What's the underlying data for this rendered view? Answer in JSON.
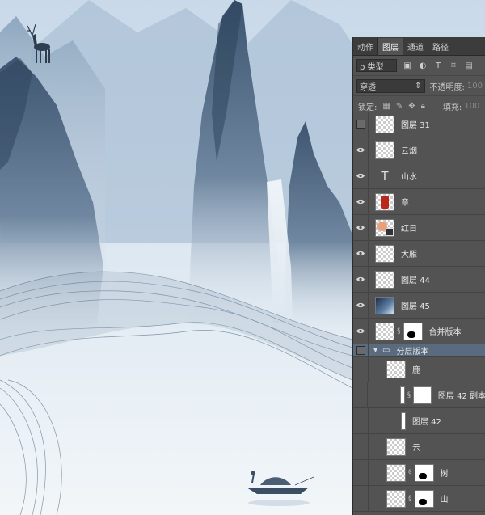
{
  "panel": {
    "tabs": [
      "动作",
      "图层",
      "通道",
      "路径"
    ],
    "active_tab": "图层",
    "filter_label": "ρ 类型",
    "blend_mode": "穿透",
    "opacity_label": "不透明度:",
    "opacity_value": "100",
    "lock_label": "锁定:",
    "fill_label": "填充:",
    "fill_value": "100"
  },
  "layers": [
    {
      "name": "图层 31",
      "visible": false,
      "type": "pixel"
    },
    {
      "name": "云烟",
      "visible": true,
      "type": "pixel"
    },
    {
      "name": "山水",
      "visible": true,
      "type": "text"
    },
    {
      "name": "章",
      "visible": true,
      "type": "seal"
    },
    {
      "name": "红日",
      "visible": true,
      "type": "smart"
    },
    {
      "name": "大雁",
      "visible": true,
      "type": "pixel"
    },
    {
      "name": "图层 44",
      "visible": true,
      "type": "pixel"
    },
    {
      "name": "图层 45",
      "visible": true,
      "type": "gradient"
    },
    {
      "name": "合并版本",
      "visible": true,
      "type": "masked"
    },
    {
      "name": "分层版本",
      "visible": false,
      "type": "group"
    },
    {
      "name": "鹿",
      "visible": false,
      "type": "pixel"
    },
    {
      "name": "图层 42 副本",
      "visible": false,
      "type": "clip-masked"
    },
    {
      "name": "图层 42",
      "visible": false,
      "type": "clip"
    },
    {
      "name": "云",
      "visible": false,
      "type": "pixel"
    },
    {
      "name": "树",
      "visible": false,
      "type": "masked"
    },
    {
      "name": "山",
      "visible": false,
      "type": "masked"
    }
  ],
  "colors": {
    "panel_bg": "#535353",
    "group_highlight": "#5a6b80",
    "seal_red": "#b8281c"
  }
}
